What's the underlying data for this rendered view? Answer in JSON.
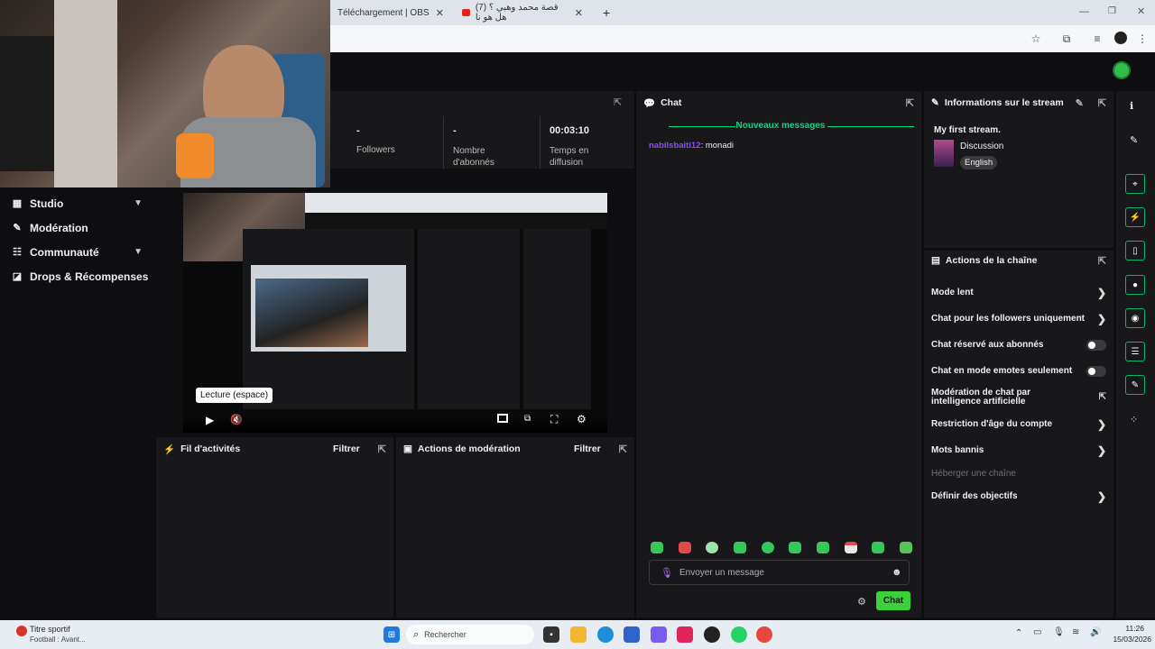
{
  "browser": {
    "tabs": [
      {
        "label": "Téléchargement | OBS"
      },
      {
        "label": "(7) قصة محمد وهبي ؟ هل هو نا"
      }
    ],
    "new_tab": "+"
  },
  "stats": {
    "followers_value": "-",
    "followers_label": "Followers",
    "subs_value": "-",
    "subs_label": "Nombre d'abonnés",
    "time_value": "00:03:10",
    "time_label": "Temps en diffusion"
  },
  "sidebar": {
    "items": [
      {
        "label": "Studio",
        "icon": "studio-icon"
      },
      {
        "label": "Modération",
        "icon": "wrench-icon"
      },
      {
        "label": "Communauté",
        "icon": "community-icon"
      },
      {
        "label": "Drops & Récompenses",
        "icon": "drops-icon"
      }
    ]
  },
  "player": {
    "tooltip": "Lecture (espace)"
  },
  "activity": {
    "title": "Fil d'activités",
    "filter": "Filtrer"
  },
  "modactions": {
    "title": "Actions de modération",
    "filter": "Filtrer"
  },
  "chat": {
    "title": "Chat",
    "new_messages": "Nouveaux messages",
    "messages": [
      {
        "user": "nabilsbaiti12",
        "sep": ":",
        "text": "monadi"
      }
    ],
    "input_placeholder": "Envoyer un message",
    "send_label": "Chat"
  },
  "stream_info": {
    "title": "Informations sur le stream",
    "stream_title": "My first stream.",
    "category": "Discussion",
    "language": "English"
  },
  "channel_actions": {
    "title": "Actions de la chaîne",
    "items": [
      {
        "label": "Mode lent",
        "control": "arrow"
      },
      {
        "label": "Chat pour les followers uniquement",
        "control": "arrow"
      },
      {
        "label": "Chat réservé aux abonnés",
        "control": "toggle"
      },
      {
        "label": "Chat en mode emotes seulement",
        "control": "toggle"
      },
      {
        "label": "Modération de chat par intelligence artificielle",
        "control": "external"
      },
      {
        "label": "Restriction d'âge du compte",
        "control": "arrow"
      },
      {
        "label": "Mots bannis",
        "control": "arrow"
      },
      {
        "label": "Héberger une chaîne",
        "control": "none"
      },
      {
        "label": "Définir des objectifs",
        "control": "arrow"
      }
    ]
  },
  "taskbar": {
    "widget_title": "Titre sportif",
    "widget_sub": "Football : Avant...",
    "search_placeholder": "Rechercher",
    "time": "11:26",
    "date": "15/03/2026"
  },
  "colors": {
    "accent_green": "#00db84",
    "username_purple": "#9147ff",
    "send_green": "#3bd13b"
  }
}
